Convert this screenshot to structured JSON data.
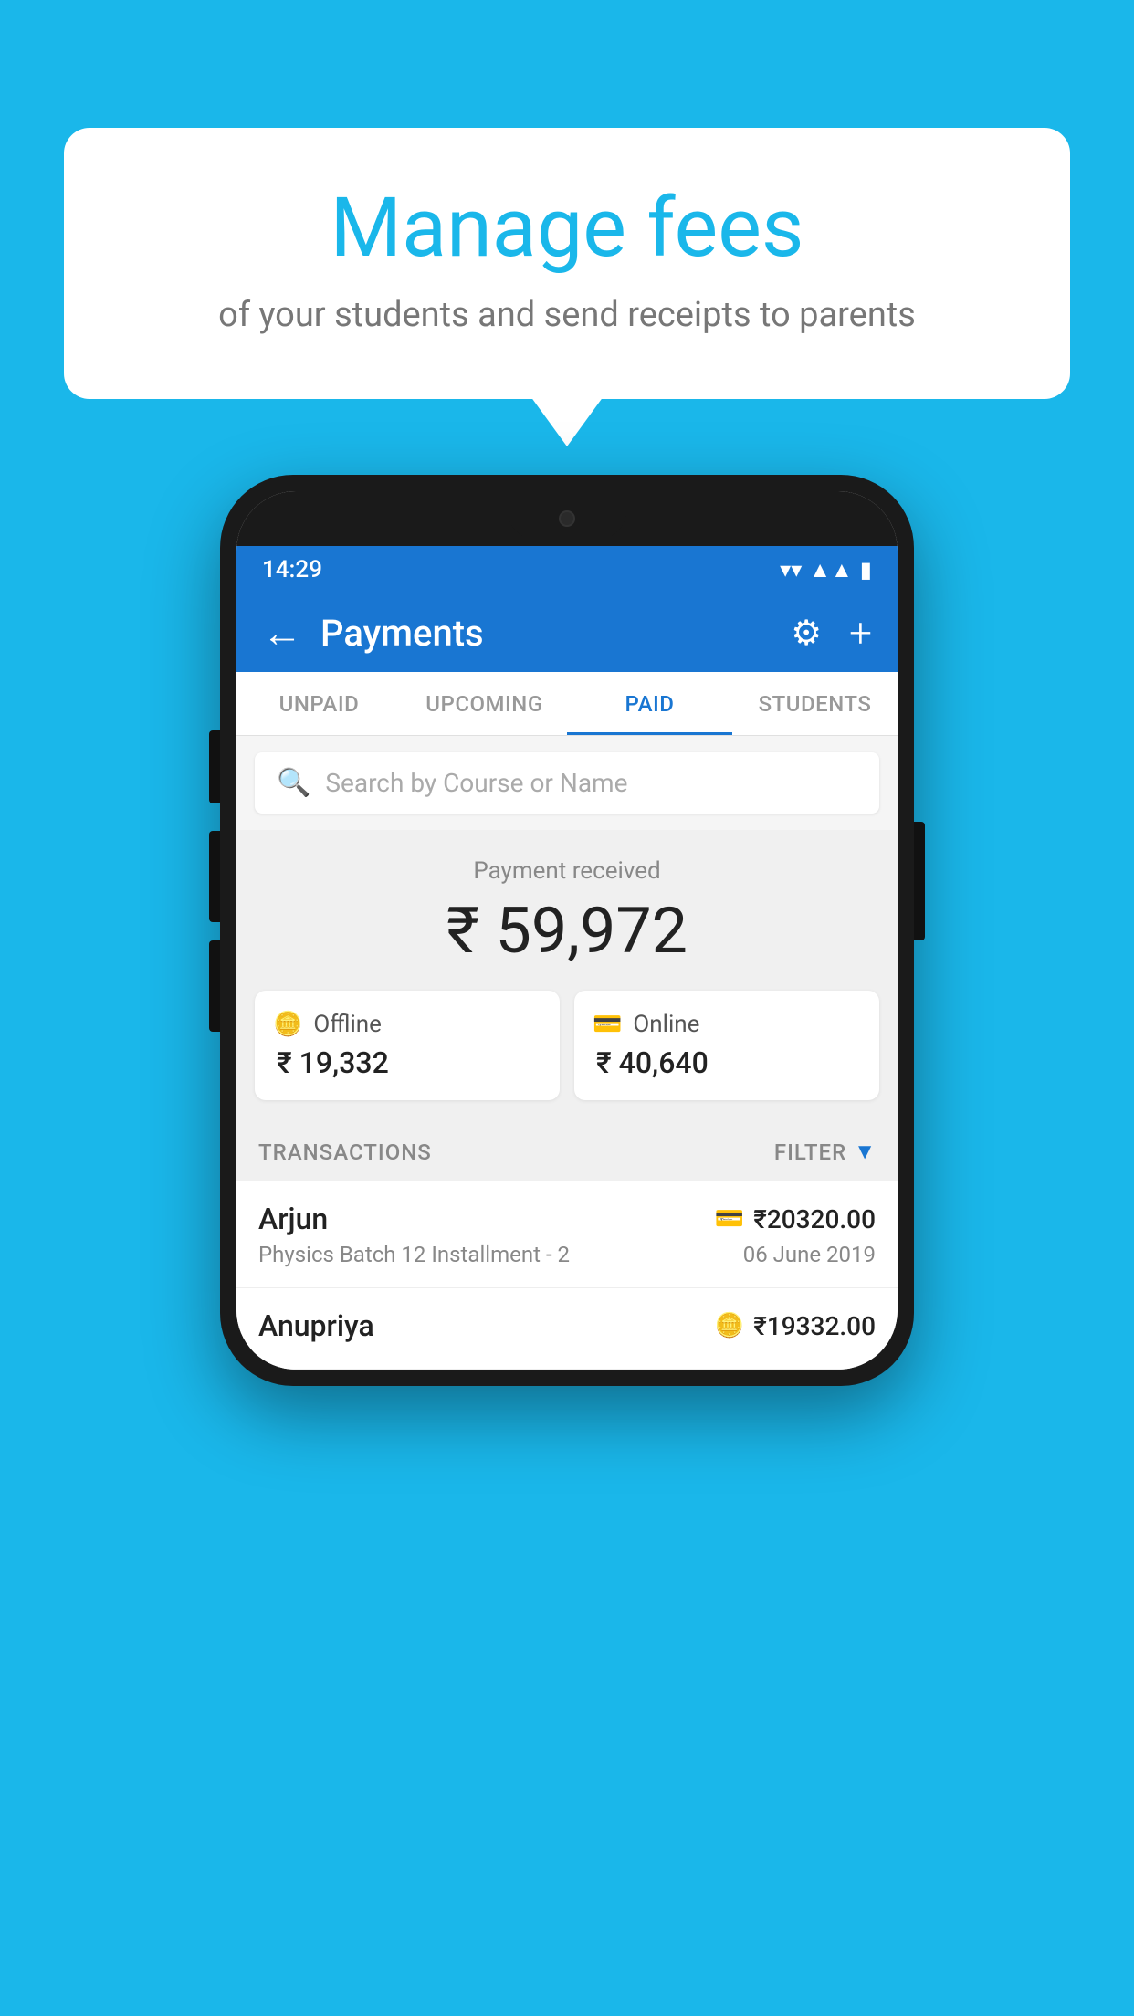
{
  "background_color": "#1ab7ea",
  "bubble": {
    "title": "Manage fees",
    "subtitle": "of your students and send receipts to parents"
  },
  "status_bar": {
    "time": "14:29",
    "wifi": "▼",
    "signal": "▲",
    "battery": "▮"
  },
  "header": {
    "title": "Payments",
    "back_label": "←",
    "gear_label": "⚙",
    "plus_label": "+"
  },
  "tabs": [
    {
      "id": "unpaid",
      "label": "UNPAID",
      "active": false
    },
    {
      "id": "upcoming",
      "label": "UPCOMING",
      "active": false
    },
    {
      "id": "paid",
      "label": "PAID",
      "active": true
    },
    {
      "id": "students",
      "label": "STUDENTS",
      "active": false
    }
  ],
  "search": {
    "placeholder": "Search by Course or Name"
  },
  "payment_summary": {
    "label": "Payment received",
    "amount": "₹ 59,972",
    "offline": {
      "type": "Offline",
      "amount": "₹ 19,332"
    },
    "online": {
      "type": "Online",
      "amount": "₹ 40,640"
    }
  },
  "transactions": {
    "header_label": "TRANSACTIONS",
    "filter_label": "FILTER",
    "items": [
      {
        "name": "Arjun",
        "course": "Physics Batch 12 Installment - 2",
        "amount": "₹20320.00",
        "date": "06 June 2019",
        "method": "card"
      },
      {
        "name": "Anupriya",
        "course": "",
        "amount": "₹19332.00",
        "date": "",
        "method": "cash"
      }
    ]
  },
  "colors": {
    "primary": "#1976d2",
    "accent": "#1ab7ea",
    "text_dark": "#222222",
    "text_muted": "#888888",
    "bg_light": "#f0f0f0"
  }
}
